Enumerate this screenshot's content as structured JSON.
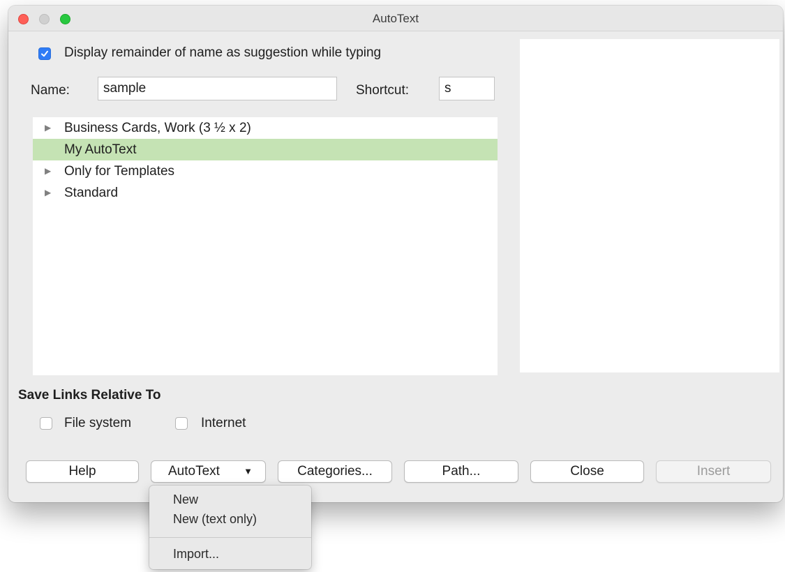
{
  "window": {
    "title": "AutoText"
  },
  "options": {
    "suggestion_checkbox": {
      "label": "Display remainder of name as suggestion while typing",
      "checked": true
    }
  },
  "name_field": {
    "label": "Name:",
    "value": "sample"
  },
  "shortcut_field": {
    "label": "Shortcut:",
    "value": "s"
  },
  "tree": {
    "items": [
      {
        "label": "Business Cards, Work (3 ½ x 2)",
        "expandable": true,
        "selected": false
      },
      {
        "label": "My AutoText",
        "expandable": false,
        "selected": true
      },
      {
        "label": "Only for Templates",
        "expandable": true,
        "selected": false
      },
      {
        "label": "Standard",
        "expandable": true,
        "selected": false
      }
    ]
  },
  "save_links": {
    "heading": "Save Links Relative To",
    "file_system": {
      "label": "File system",
      "checked": false
    },
    "internet": {
      "label": "Internet",
      "checked": false
    }
  },
  "buttons": {
    "help": "Help",
    "autotext": "AutoText",
    "categories": "Categories...",
    "path": "Path...",
    "close": "Close",
    "insert": "Insert"
  },
  "dropdown_menu": {
    "items": [
      "New",
      "New (text only)",
      "Import..."
    ]
  },
  "colors": {
    "accent": "#2e7cf6",
    "selection": "#c5e3b4",
    "window_bg": "#ececec",
    "close_light": "#fe5f57",
    "zoom_light": "#28c840"
  }
}
